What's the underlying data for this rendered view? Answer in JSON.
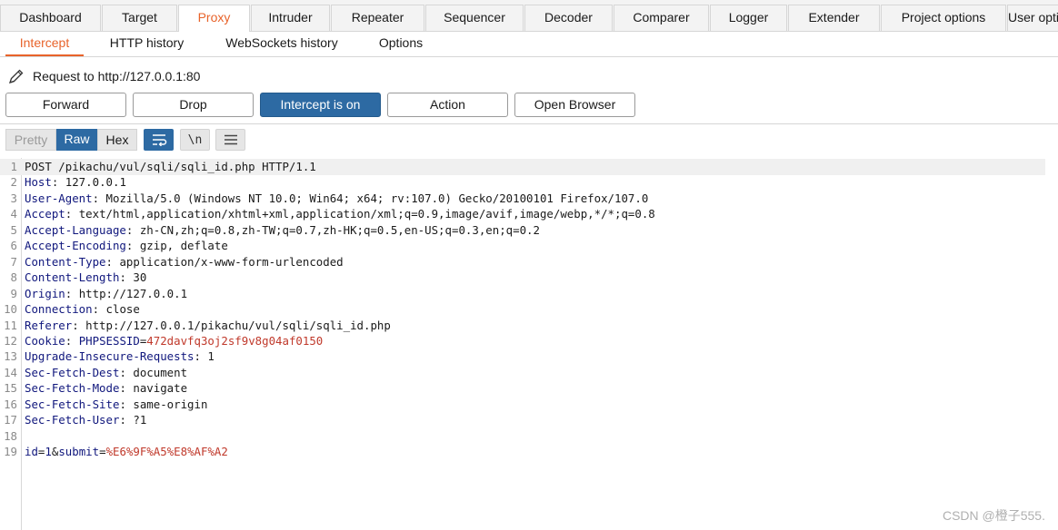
{
  "main_tabs": [
    "Dashboard",
    "Target",
    "Proxy",
    "Intruder",
    "Repeater",
    "Sequencer",
    "Decoder",
    "Comparer",
    "Logger",
    "Extender",
    "Project options",
    "User options"
  ],
  "main_tab_active": "Proxy",
  "sub_tabs": [
    "Intercept",
    "HTTP history",
    "WebSockets history",
    "Options"
  ],
  "sub_tab_active": "Intercept",
  "request_label": "Request to http://127.0.0.1:80",
  "buttons": {
    "forward": "Forward",
    "drop": "Drop",
    "intercept": "Intercept is on",
    "action": "Action",
    "open_browser": "Open Browser"
  },
  "view_modes": {
    "pretty": "Pretty",
    "raw": "Raw",
    "hex": "Hex",
    "newline_toggle": "\\n"
  },
  "icons": {
    "edit": "pencil-icon",
    "wrap": "wrap-lines-icon",
    "menu": "hamburger-menu-icon"
  },
  "colors": {
    "accent_orange": "#e8632a",
    "primary_blue": "#2d6aa3",
    "header_name": "#10177d",
    "cookie_value": "#c0392b"
  },
  "request_lines": [
    {
      "n": "1",
      "text": "POST /pikachu/vul/sqli/sqli_id.php HTTP/1.1"
    },
    {
      "n": "2",
      "name": "Host",
      "value": "127.0.0.1"
    },
    {
      "n": "3",
      "name": "User-Agent",
      "value": "Mozilla/5.0 (Windows NT 10.0; Win64; x64; rv:107.0) Gecko/20100101 Firefox/107.0"
    },
    {
      "n": "4",
      "name": "Accept",
      "value": "text/html,application/xhtml+xml,application/xml;q=0.9,image/avif,image/webp,*/*;q=0.8"
    },
    {
      "n": "5",
      "name": "Accept-Language",
      "value": "zh-CN,zh;q=0.8,zh-TW;q=0.7,zh-HK;q=0.5,en-US;q=0.3,en;q=0.2"
    },
    {
      "n": "6",
      "name": "Accept-Encoding",
      "value": "gzip, deflate"
    },
    {
      "n": "7",
      "name": "Content-Type",
      "value": "application/x-www-form-urlencoded"
    },
    {
      "n": "8",
      "name": "Content-Length",
      "value": "30"
    },
    {
      "n": "9",
      "name": "Origin",
      "value": "http://127.0.0.1"
    },
    {
      "n": "10",
      "name": "Connection",
      "value": "close"
    },
    {
      "n": "11",
      "name": "Referer",
      "value": "http://127.0.0.1/pikachu/vul/sqli/sqli_id.php"
    },
    {
      "n": "12",
      "name": "Cookie",
      "cookie_name": "PHPSESSID",
      "cookie_value": "472davfq3oj2sf9v8g04af0150"
    },
    {
      "n": "13",
      "name": "Upgrade-Insecure-Requests",
      "value": "1"
    },
    {
      "n": "14",
      "name": "Sec-Fetch-Dest",
      "value": "document"
    },
    {
      "n": "15",
      "name": "Sec-Fetch-Mode",
      "value": "navigate"
    },
    {
      "n": "16",
      "name": "Sec-Fetch-Site",
      "value": "same-origin"
    },
    {
      "n": "17",
      "name": "Sec-Fetch-User",
      "value": "?1"
    },
    {
      "n": "18",
      "text": ""
    },
    {
      "n": "19",
      "body": true,
      "p1": "id",
      "v1": "1",
      "p2": "submit",
      "v2": "%E6%9F%A5%E8%AF%A2"
    }
  ],
  "watermark": "CSDN @橙子555."
}
